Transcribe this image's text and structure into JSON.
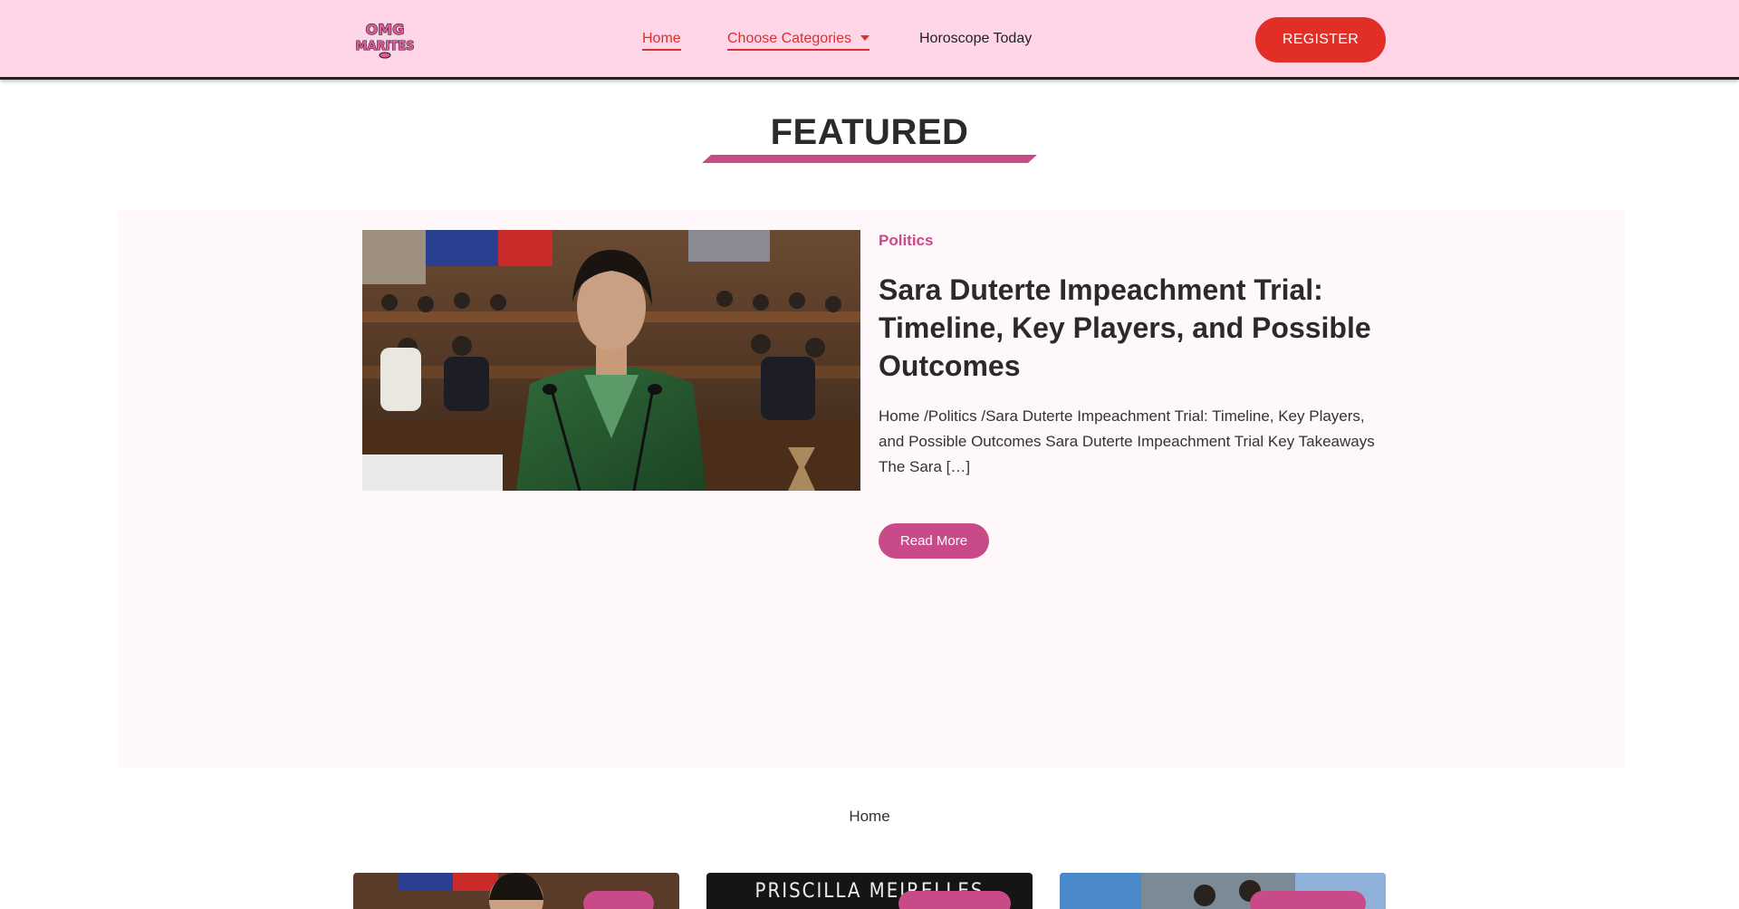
{
  "header": {
    "logo": {
      "line1": "OMG",
      "line2": "MARITES"
    },
    "nav": {
      "home": "Home",
      "categories": "Choose Categories",
      "horoscope": "Horoscope Today"
    },
    "register_label": "REGISTER"
  },
  "featured": {
    "heading": "FEATURED",
    "category": "Politics",
    "title": "Sara Duterte Impeachment Trial: Timeline, Key Players, and Possible Outcomes",
    "excerpt": "Home /Politics /Sara Duterte Impeachment Trial: Timeline, Key Players, and Possible Outcomes Sara Duterte Impeachment Trial Key Takeaways The Sara […]",
    "read_more_label": "Read More"
  },
  "section_label": "Home",
  "cards": [
    {
      "title": ""
    },
    {
      "title": "PRISCILLA MEIRELLES"
    },
    {
      "title": ""
    }
  ],
  "colors": {
    "header_bg": "#ffd6e8",
    "accent_red": "#e12f28",
    "accent_pink": "#c94a88",
    "panel_bg": "#fff8fb"
  }
}
